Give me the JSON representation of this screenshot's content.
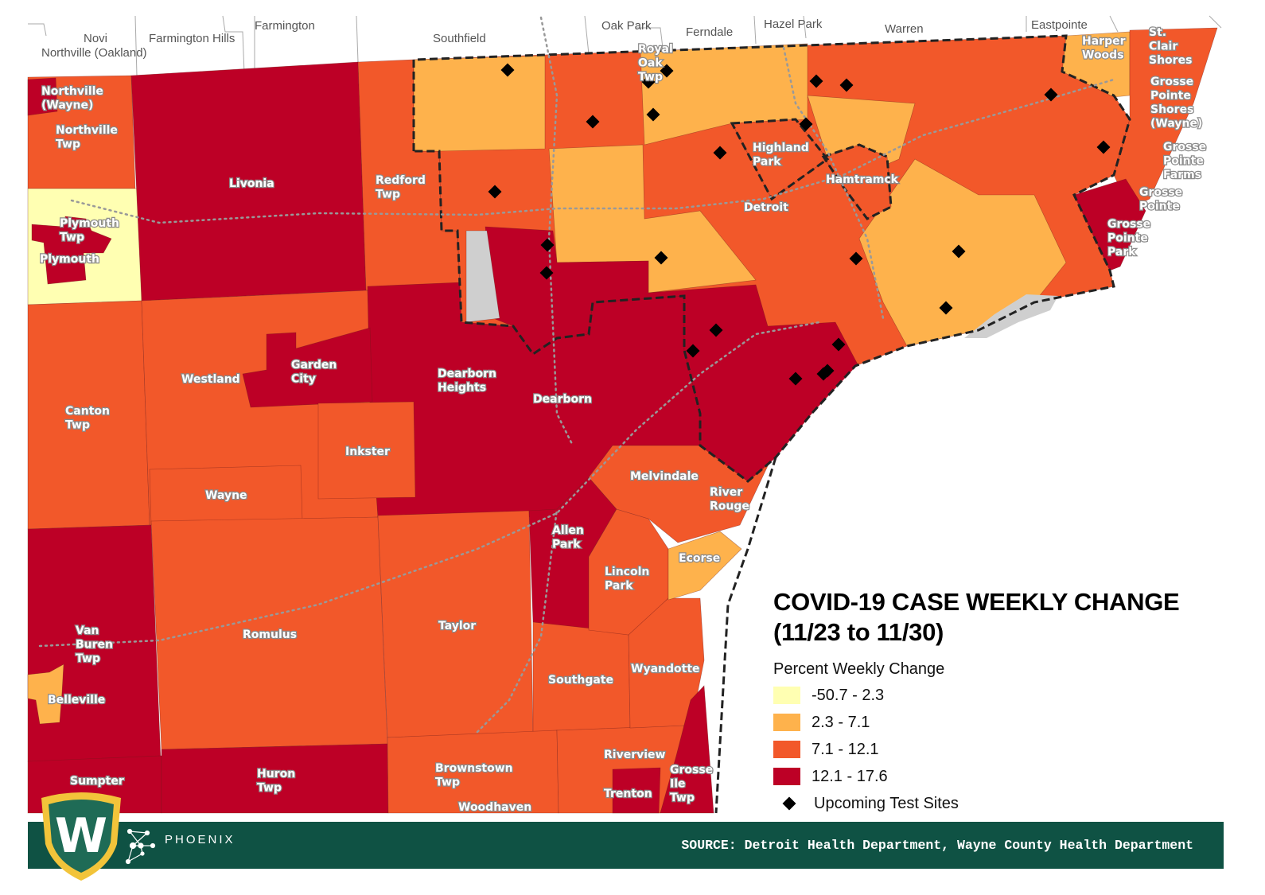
{
  "title_line1": "COVID-19 CASE WEEKLY CHANGE",
  "title_line2": "(11/23 to 11/30)",
  "legend": {
    "heading": "Percent Weekly Change",
    "classes": [
      {
        "range": "-50.7 - 2.3",
        "color": "#ffffb2"
      },
      {
        "range": "2.3 - 7.1",
        "color": "#feb24c"
      },
      {
        "range": "7.1 - 12.1",
        "color": "#f2582a"
      },
      {
        "range": "12.1 - 17.6",
        "color": "#bd0026"
      }
    ],
    "sites_label": "Upcoming Test Sites"
  },
  "oakland_labels": [
    "Novi",
    "Northville (Oakland)",
    "Farmington Hills",
    "Farmington",
    "Southfield",
    "Oak Park",
    "Royal Oak Twp",
    "Ferndale",
    "Hazel Park",
    "Warren",
    "Eastpointe",
    "Harper Woods",
    "St. Clair Shores"
  ],
  "places": [
    "Northville (Wayne)",
    "Northville Twp",
    "Plymouth Twp",
    "Plymouth",
    "Livonia",
    "Redford Twp",
    "Westland",
    "Garden City",
    "Canton Twp",
    "Dearborn Heights",
    "Dearborn",
    "Inkster",
    "Wayne",
    "Van Buren Twp",
    "Belleville",
    "Romulus",
    "Taylor",
    "Allen Park",
    "Melvindale",
    "River Rouge",
    "Ecorse",
    "Lincoln Park",
    "Southgate",
    "Wyandotte",
    "Riverview",
    "Trenton",
    "Grosse Ile Twp",
    "Brownstown Twp",
    "Woodhaven",
    "Sumpter",
    "Huron Twp",
    "Highland Park",
    "Hamtramck",
    "Detroit",
    "Grosse Pointe Shores (Wayne)",
    "Grosse Pointe Farms",
    "Grosse Pointe",
    "Grosse Pointe Park"
  ],
  "footer": {
    "logo_text": "W",
    "brand": "PHOENIX",
    "source": "SOURCE: Detroit Health Department, Wayne County Health Department"
  }
}
